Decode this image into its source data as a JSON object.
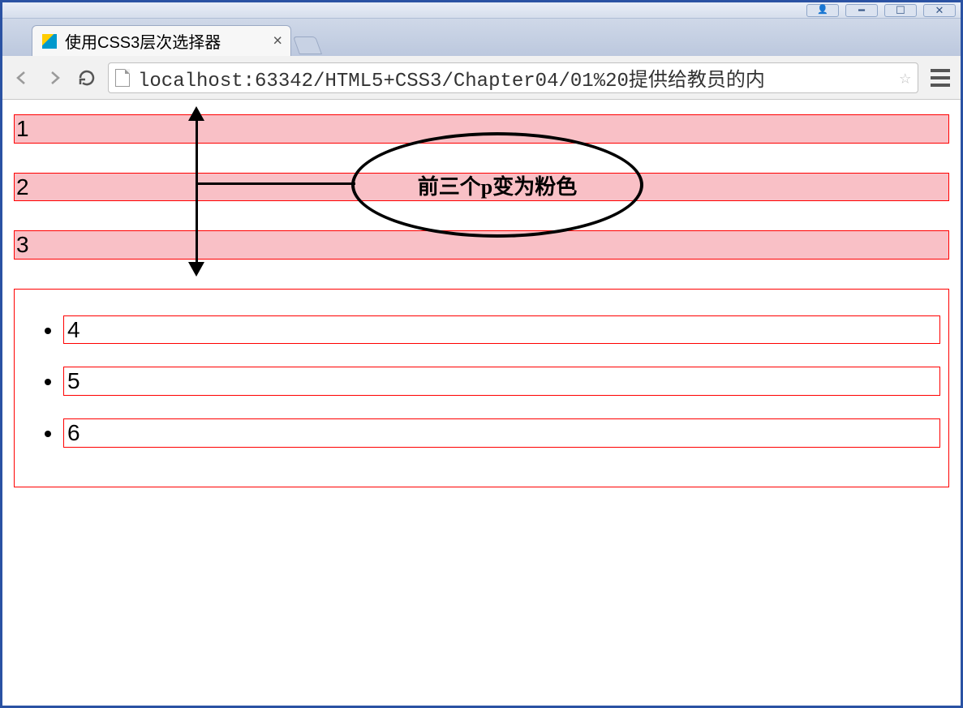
{
  "window": {
    "user_button": "",
    "minimize": "━",
    "maximize": "☐",
    "close": "✕"
  },
  "tab": {
    "title": "使用CSS3层次选择器",
    "close": "×"
  },
  "toolbar": {
    "url": "localhost:63342/HTML5+CSS3/Chapter04/01%20提供给教员的内"
  },
  "content": {
    "p1": "1",
    "p2": "2",
    "p3": "3",
    "li1": "4",
    "li2": "5",
    "li3": "6"
  },
  "annotation": {
    "text": "前三个p变为粉色"
  }
}
